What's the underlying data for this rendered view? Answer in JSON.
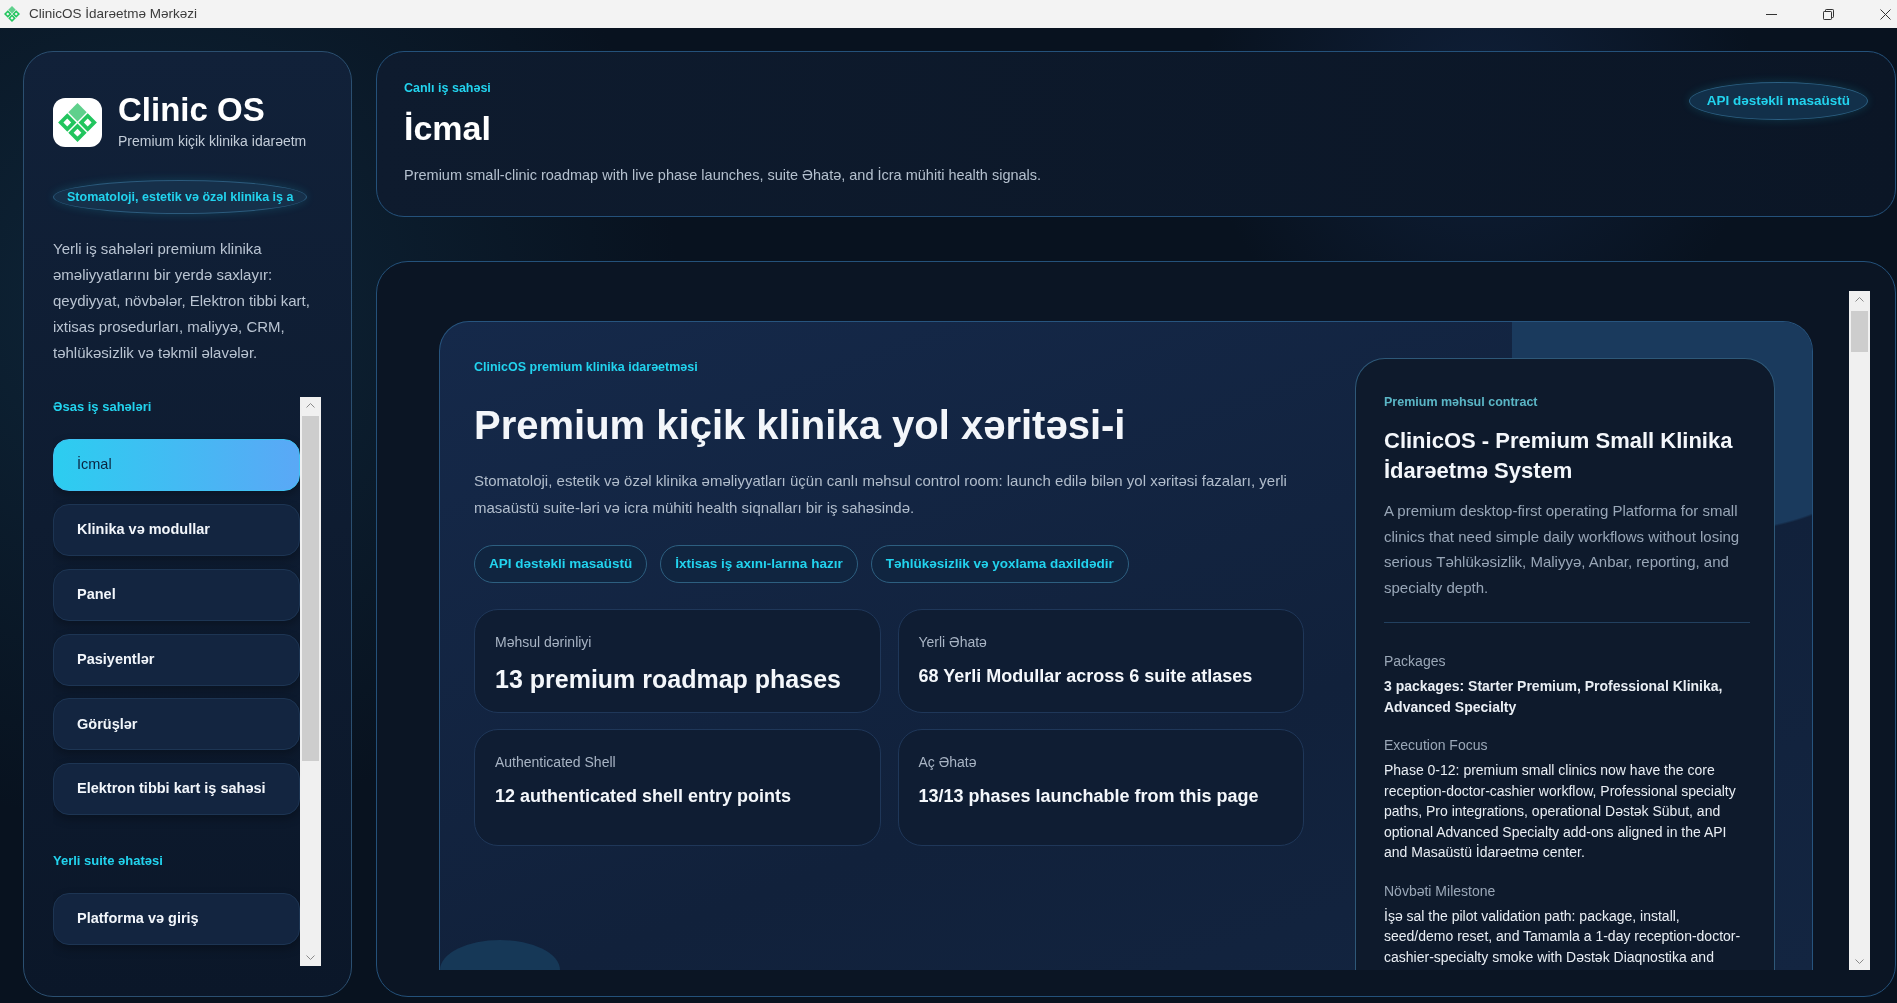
{
  "window": {
    "title": "ClinicOS İdarəetmə Mərkəzi"
  },
  "sidebar": {
    "brand": {
      "name": "Clinic OS",
      "tagline": "Premium kiçik klinika idarəetm"
    },
    "badge": "Stomatoloji, estetik və özəl klinika iş a",
    "description": "Yerli iş sahələri premium klinika əməliyyatlarını bir yerdə saxlayır: qeydiyyat, növbələr, Elektron tibbi kart, ixtisas prosedurları, maliyyə, CRM, təhlükəsizlik və təkmil əlavələr.",
    "sections": [
      {
        "title": "Əsas iş sahələri",
        "items": [
          {
            "label": "İcmal",
            "selected": true
          },
          {
            "label": "Klinika və modullar",
            "selected": false
          },
          {
            "label": "Panel",
            "selected": false
          },
          {
            "label": "Pasiyentlər",
            "selected": false
          },
          {
            "label": "Görüşlər",
            "selected": false
          },
          {
            "label": "Elektron tibbi kart iş sahəsi",
            "selected": false
          }
        ]
      },
      {
        "title": "Yerli suite əhatəsi",
        "items": [
          {
            "label": "Platforma və giriş",
            "selected": false
          }
        ]
      }
    ]
  },
  "header": {
    "eyebrow": "Canlı iş sahəsi",
    "title": "İcmal",
    "description": "Premium small-clinic roadmap with live phase launches, suite Əhatə, and İcra mühiti health signals.",
    "badge": "API dəstəkli masaüstü"
  },
  "hero": {
    "eyebrow": "ClinicOS premium klinika idarəetməsi",
    "title": "Premium kiçik klinika yol xəritəsi-i",
    "description": "Stomatoloji, estetik və özəl klinika əməliyyatları üçün canlı məhsul control room: launch edilə bilən yol xəritəsi fazaları, yerli masaüstü suite-ləri və icra mühiti health siqnalları bir iş sahəsində.",
    "tags": [
      "API dəstəkli masaüstü",
      "İxtisas iş axını-larına hazır",
      "Təhlükəsizlik və yoxlama daxildədir"
    ],
    "stats": [
      {
        "label": "Məhsul dərinliyi",
        "value": "13 premium roadmap phases",
        "kind": "primary"
      },
      {
        "label": "Yerli Əhatə",
        "value": "68 Yerli Modullar across 6 suite atlases",
        "kind": "secondary"
      },
      {
        "label": "Authenticated Shell",
        "value": "12 authenticated shell entry points",
        "kind": "secondary"
      },
      {
        "label": "Aç Əhatə",
        "value": "13/13 phases launchable from this page",
        "kind": "secondary"
      }
    ],
    "contract": {
      "eyebrow": "Premium məhsul contract",
      "title": "ClinicOS - Premium Small Klinika İdarəetmə System",
      "description": "A premium desktop-first operating Platforma for small clinics that need simple daily workflows without losing serious Təhlükəsizlik, Maliyyə, Anbar, reporting, and specialty depth.",
      "details": [
        {
          "label": "Packages",
          "value": "3 packages: Starter Premium, Professional Klinika, Advanced Specialty",
          "kind": "highlight"
        },
        {
          "label": "Execution Focus",
          "value": "Phase 0-12: premium small clinics now have the core reception-doctor-cashier workflow, Professional specialty paths, Pro integrations, operational Dəstək Sübut, and optional Advanced Specialty add-ons aligned in the API and Masaüstü İdarəetmə center.",
          "kind": "plain"
        },
        {
          "label": "Növbəti Milestone",
          "value": "İşə sal the pilot validation path: package, install, seed/demo reset, and Tamamla a 1-day reception-doctor-cashier-specialty smoke with Dəstək Diaqnostika and",
          "kind": "plain"
        }
      ]
    }
  }
}
